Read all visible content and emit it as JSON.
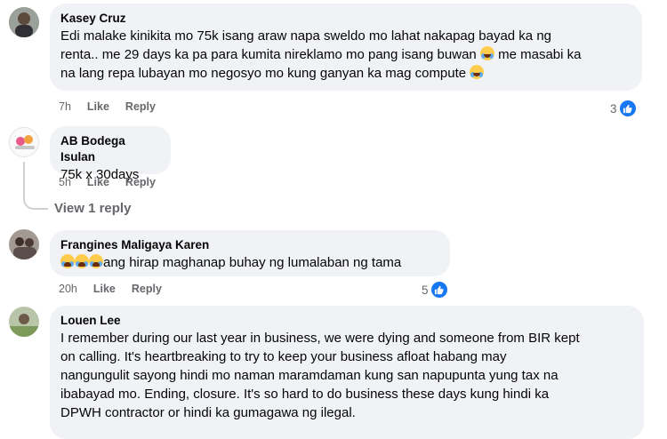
{
  "comments": [
    {
      "author": "Kasey Cruz",
      "lines": [
        "Edi malake kinikita mo 75k isang araw napa sweldo mo lahat nakapag bayad ka ng",
        "renta.. me 29 days ka pa para kumita nireklamo mo pang isang buwan",
        "me masabi ka",
        "na lang repa lubayan mo negosyo mo kung ganyan ka mag compute"
      ],
      "time": "7h",
      "like_label": "Like",
      "reply_label": "Reply",
      "reactions": "3"
    },
    {
      "author": "AB Bodega Isulan",
      "text": "75k x 30days",
      "time": "5h",
      "like_label": "Like",
      "reply_label": "Reply",
      "view_replies": "View 1 reply"
    },
    {
      "author": "Frangines Maligaya Karen",
      "text": "ang hirap maghanap buhay ng lumalaban ng tama",
      "time": "20h",
      "like_label": "Like",
      "reply_label": "Reply",
      "reactions": "5"
    },
    {
      "author": "Louen Lee",
      "lines": [
        "I remember during our last year in business, we were dying and someone from BIR kept",
        "on calling. It's heartbreaking to try to keep your business afloat habang may",
        "nangungulit sayong hindi mo naman maramdaman kung san napupunta yung tax na",
        "ibabayad mo. Ending, closure. It's so hard to do business these days kung hindi ka",
        "DPWH contractor or hindi ka gumagawa ng ilegal."
      ]
    }
  ],
  "colors": {
    "bubble": "#f0f2f5",
    "meta": "#65676b",
    "like_blue": "#1877f2"
  }
}
